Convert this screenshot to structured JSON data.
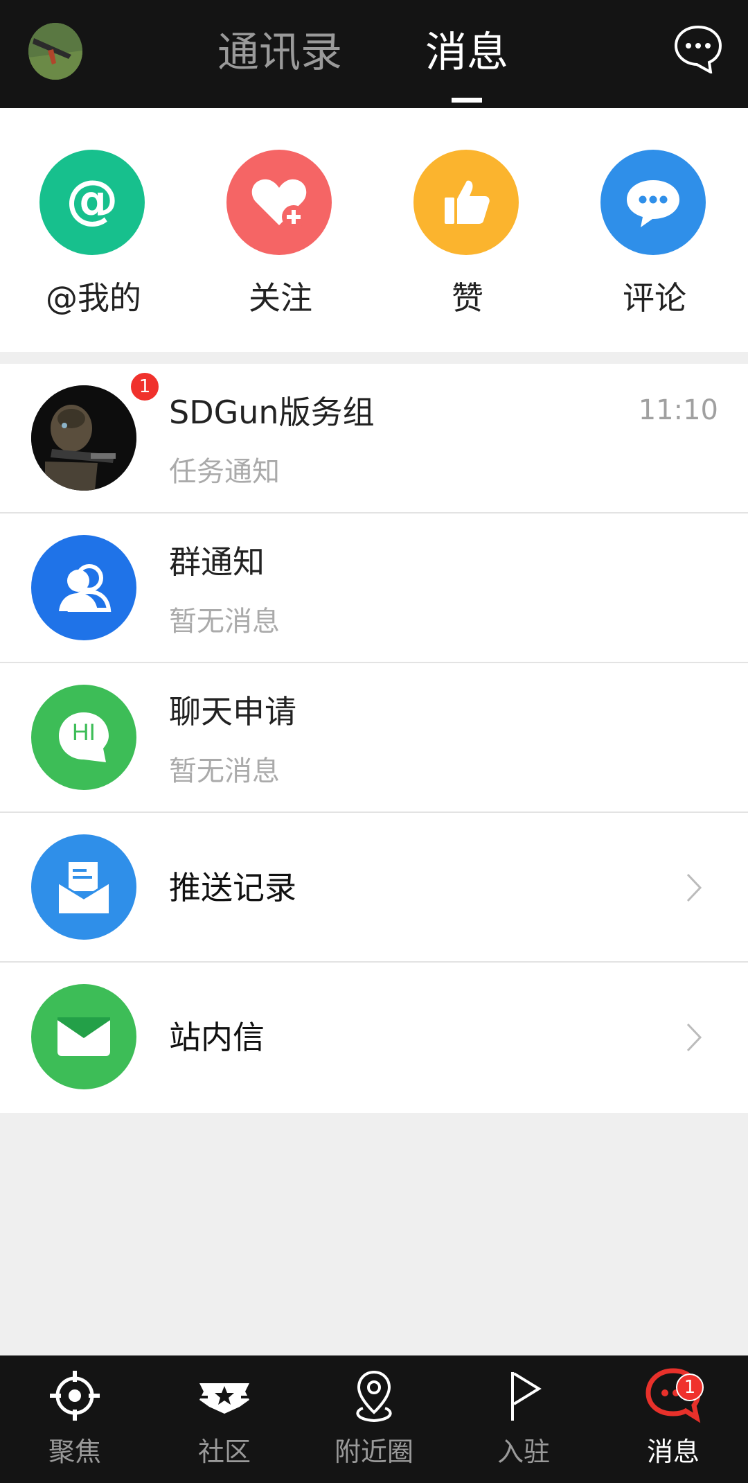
{
  "header": {
    "tabs": [
      {
        "label": "通讯录",
        "active": false
      },
      {
        "label": "消息",
        "active": true
      }
    ],
    "avatar_icon": "user-avatar",
    "action_icon": "chat-bubble-icon"
  },
  "quick_actions": [
    {
      "label": "@我的",
      "icon": "at-icon",
      "color": "#17c08d"
    },
    {
      "label": "关注",
      "icon": "heart-plus-icon",
      "color": "#f56565"
    },
    {
      "label": "赞",
      "icon": "thumbs-up-icon",
      "color": "#fbb42e"
    },
    {
      "label": "评论",
      "icon": "comment-icon",
      "color": "#2f8fe9"
    }
  ],
  "messages": [
    {
      "title": "SDGun版务组",
      "subtitle": "任务通知",
      "time": "11:10",
      "badge": "1",
      "icon": "group-avatar"
    },
    {
      "title": "群通知",
      "subtitle": "暂无消息",
      "icon": "group-icon",
      "color": "#1f73e8"
    },
    {
      "title": "聊天申请",
      "subtitle": "暂无消息",
      "icon": "hi-bubble-icon",
      "icon_text": "HI",
      "color": "#3dbd57"
    },
    {
      "title": "推送记录",
      "icon": "push-record-icon",
      "color": "#2f8fe9"
    },
    {
      "title": "站内信",
      "icon": "mail-icon",
      "color": "#3dbd57"
    }
  ],
  "bottom_nav": [
    {
      "label": "聚焦",
      "icon": "crosshair-icon",
      "active": false
    },
    {
      "label": "社区",
      "icon": "badge-star-icon",
      "active": false
    },
    {
      "label": "附近圈",
      "icon": "location-pin-icon",
      "active": false
    },
    {
      "label": "入驻",
      "icon": "flag-icon",
      "active": false
    },
    {
      "label": "消息",
      "icon": "message-icon",
      "active": true,
      "badge": "1",
      "color": "#e8312b"
    }
  ]
}
